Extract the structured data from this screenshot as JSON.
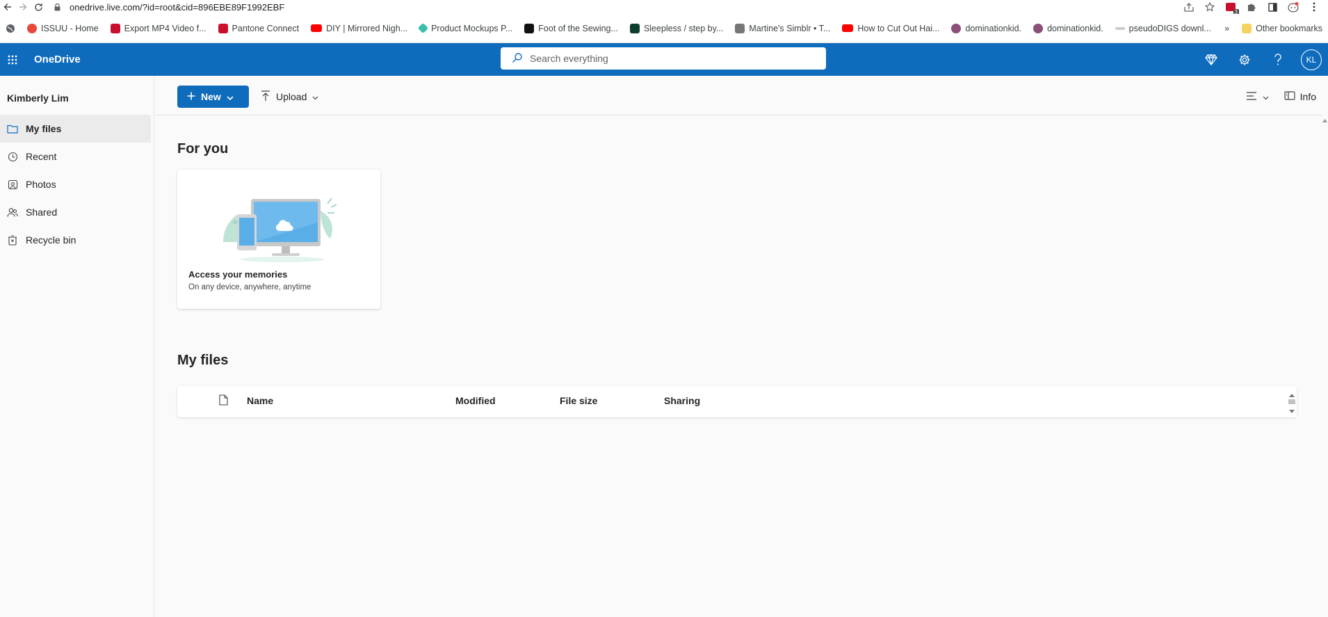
{
  "browser": {
    "url": "onedrive.live.com/?id=root&cid=896EBE89F1992EBF",
    "ext_badge": "3"
  },
  "bookmarks": [
    {
      "label": "ISSUU - Home",
      "color": "#e8473e"
    },
    {
      "label": "Export MP4 Video f...",
      "color": "#c8102e"
    },
    {
      "label": "Pantone Connect",
      "color": "#c8102e"
    },
    {
      "label": "DIY | Mirrored Nigh...",
      "color": "#ff0000"
    },
    {
      "label": "Product Mockups P...",
      "color": "#3bbfad"
    },
    {
      "label": "Foot of the Sewing...",
      "color": "#111111"
    },
    {
      "label": "Sleepless / step by...",
      "color": "#0f3d2e"
    },
    {
      "label": "Martine's Simblr • T...",
      "color": "#777777"
    },
    {
      "label": "How to Cut Out Hai...",
      "color": "#ff0000"
    },
    {
      "label": "dominationkid.",
      "color": "#8b4f7a"
    },
    {
      "label": "dominationkid.",
      "color": "#8b4f7a"
    },
    {
      "label": "pseudoDIGS downl...",
      "color": "#bbbbbb"
    }
  ],
  "bookmarks_other": "Other bookmarks",
  "appbar": {
    "brand": "OneDrive",
    "search_placeholder": "Search everything",
    "avatar_initials": "KL",
    "color": "#0f6cbd"
  },
  "sidebar": {
    "user": "Kimberly Lim",
    "items": [
      {
        "label": "My files",
        "icon": "folder-icon",
        "active": true
      },
      {
        "label": "Recent",
        "icon": "clock-icon",
        "active": false
      },
      {
        "label": "Photos",
        "icon": "photo-icon",
        "active": false
      },
      {
        "label": "Shared",
        "icon": "people-icon",
        "active": false
      },
      {
        "label": "Recycle bin",
        "icon": "trash-icon",
        "active": false
      }
    ]
  },
  "toolbar": {
    "new_label": "New",
    "upload_label": "Upload",
    "info_label": "Info"
  },
  "for_you": {
    "heading": "For you",
    "card_title": "Access your memories",
    "card_subtitle": "On any device, anywhere, anytime"
  },
  "my_files": {
    "heading": "My files",
    "columns": [
      "Name",
      "Modified",
      "File size",
      "Sharing"
    ]
  }
}
